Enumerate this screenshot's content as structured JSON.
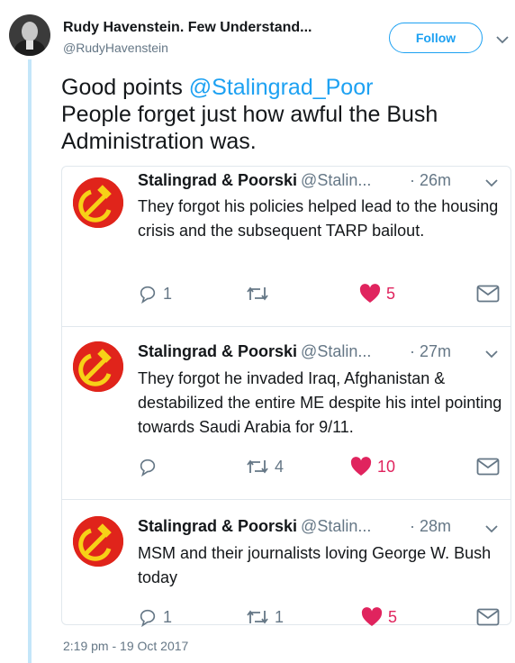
{
  "author": {
    "name": "Rudy Havenstein. Few Understand...",
    "handle": "@RudyHavenstein"
  },
  "follow_label": "Follow",
  "tweet": {
    "text_prefix": "Good points ",
    "mention": "@Stalingrad_Poor",
    "text_rest": "People forget just how awful the Bush Administration was."
  },
  "replies": [
    {
      "name": "Stalingrad & Poorski",
      "handle": "@Stalin...",
      "time": "· 26m",
      "text": "They forgot his policies helped lead to the housing crisis and the subsequent TARP bailout.",
      "reply_count": "1",
      "retweet_count": "",
      "like_count": "5"
    },
    {
      "name": "Stalingrad & Poorski",
      "handle": "@Stalin...",
      "time": "· 27m",
      "text": "They forgot he invaded Iraq, Afghanistan & destabilized the entire ME despite his intel pointing towards Saudi Arabia for 9/11.",
      "reply_count": "",
      "retweet_count": "4",
      "like_count": "10"
    },
    {
      "name": "Stalingrad & Poorski",
      "handle": "@Stalin...",
      "time": "· 28m",
      "text": "MSM and their journalists loving George W. Bush today",
      "reply_count": "1",
      "retweet_count": "1",
      "like_count": "5"
    }
  ],
  "timestamp": "2:19 pm - 19 Oct 2017",
  "colors": {
    "accent": "#1da1f2",
    "like": "#e0245e",
    "avatar_red": "#e0241b",
    "hammer_sickle": "#f7d117"
  }
}
